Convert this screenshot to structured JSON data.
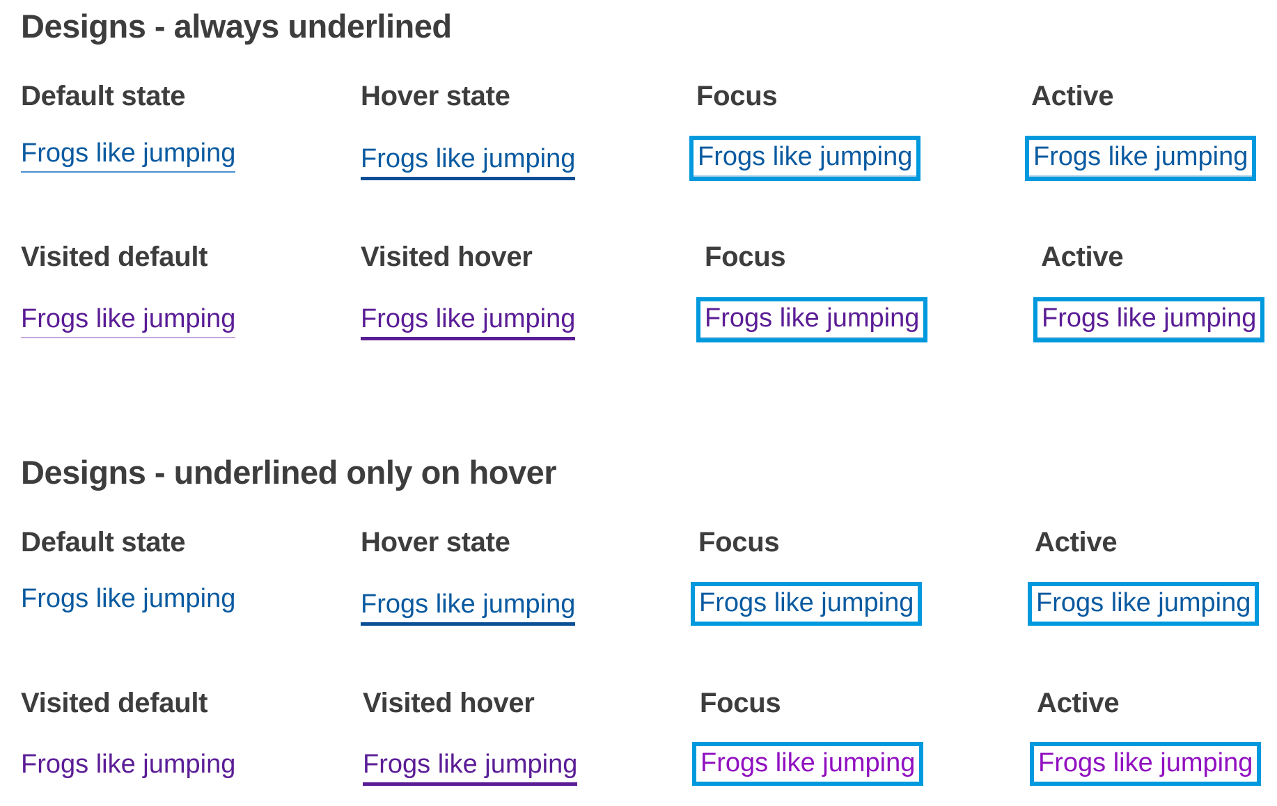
{
  "sections": [
    {
      "title": "Designs - always underlined",
      "rows": [
        {
          "cells": [
            {
              "label": "Default state",
              "link": "Frogs like jumping"
            },
            {
              "label": "Hover state",
              "link": "Frogs like jumping"
            },
            {
              "label": "Focus",
              "link": "Frogs like jumping"
            },
            {
              "label": "Active",
              "link": "Frogs like jumping"
            }
          ]
        },
        {
          "cells": [
            {
              "label": "Visited default",
              "link": "Frogs like jumping"
            },
            {
              "label": "Visited hover",
              "link": "Frogs like jumping"
            },
            {
              "label": "Focus",
              "link": "Frogs like jumping"
            },
            {
              "label": "Active",
              "link": "Frogs like jumping"
            }
          ]
        }
      ]
    },
    {
      "title": "Designs - underlined only on hover",
      "rows": [
        {
          "cells": [
            {
              "label": "Default state",
              "link": "Frogs like jumping"
            },
            {
              "label": "Hover state",
              "link": "Frogs like jumping"
            },
            {
              "label": "Focus",
              "link": "Frogs like jumping"
            },
            {
              "label": "Active",
              "link": "Frogs like jumping"
            }
          ]
        },
        {
          "cells": [
            {
              "label": "Visited default",
              "link": "Frogs like jumping"
            },
            {
              "label": "Visited hover",
              "link": "Frogs like jumping"
            },
            {
              "label": "Focus",
              "link": "Frogs like jumping"
            },
            {
              "label": "Active",
              "link": "Frogs like jumping"
            }
          ]
        }
      ]
    }
  ],
  "colors": {
    "link_default": "#0a5aa0",
    "link_visited": "#5b1d96",
    "link_visited_focus": "#9010c0",
    "focus_outline": "#0099dd",
    "heading": "#3d3d3d"
  }
}
